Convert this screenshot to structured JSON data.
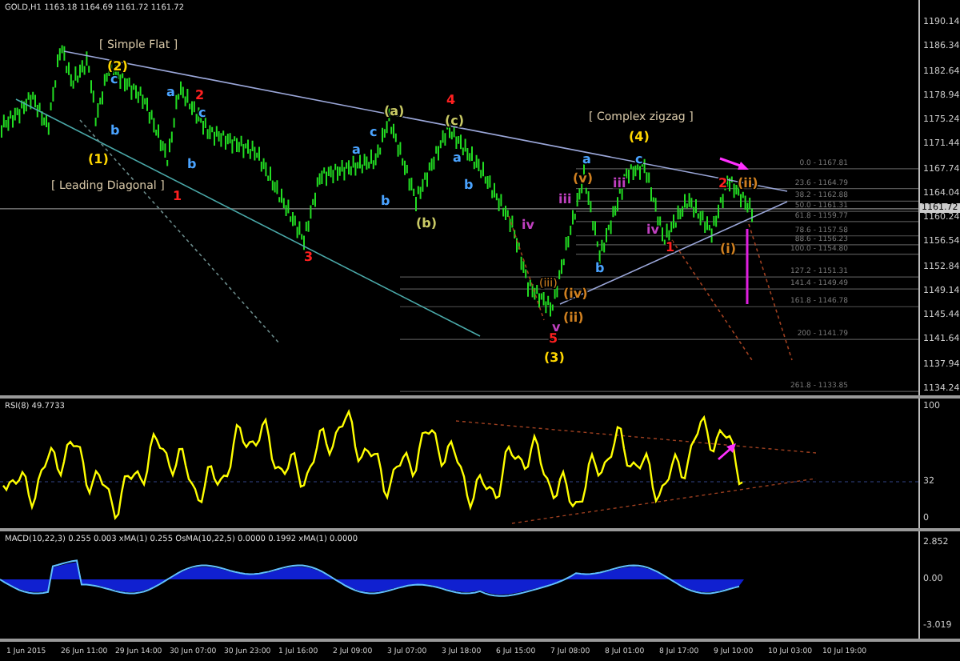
{
  "header": "GOLD,H1  1163.18 1164.69 1161.72 1161.72",
  "price_axis": {
    "ticks": [
      "1190.14",
      "1186.34",
      "1182.64",
      "1178.94",
      "1175.24",
      "1171.44",
      "1167.74",
      "1164.04",
      "1160.24",
      "1156.54",
      "1152.84",
      "1149.14",
      "1145.44",
      "1141.64",
      "1137.94",
      "1134.24"
    ],
    "current": "1161.72"
  },
  "fib_levels": [
    "0.0 - 1167.81",
    "23.6 - 1164.79",
    "38.2 - 1162.88",
    "50.0 - 1161.31",
    "61.8 - 1159.77",
    "78.6 - 1157.58",
    "88.6 - 1156.23",
    "100.0 - 1154.80",
    "127.2 - 1151.31",
    "141.4 - 1149.49",
    "161.8 - 1146.78",
    "200 - 1141.79",
    "261.8 - 1133.85"
  ],
  "wave_labels": [
    {
      "text": "[ Simple Flat ]",
      "color": "#d8c8a8"
    },
    {
      "text": "(2)",
      "color": "#ffd700"
    },
    {
      "text": "c",
      "color": "#4aa3ff"
    },
    {
      "text": "a",
      "color": "#4aa3ff"
    },
    {
      "text": "2",
      "color": "#ff2020"
    },
    {
      "text": "4",
      "color": "#ff2020"
    },
    {
      "text": "c",
      "color": "#4aa3ff"
    },
    {
      "text": "(a)",
      "color": "#c8c864"
    },
    {
      "text": "(c)",
      "color": "#c8c864"
    },
    {
      "text": "[ Complex zigzag ]",
      "color": "#d8c8a8"
    },
    {
      "text": "b",
      "color": "#4aa3ff"
    },
    {
      "text": "c",
      "color": "#4aa3ff"
    },
    {
      "text": "(4)",
      "color": "#ffd700"
    },
    {
      "text": "(1)",
      "color": "#ffd700"
    },
    {
      "text": "b",
      "color": "#4aa3ff"
    },
    {
      "text": "a",
      "color": "#4aa3ff"
    },
    {
      "text": "a",
      "color": "#4aa3ff"
    },
    {
      "text": "a",
      "color": "#4aa3ff"
    },
    {
      "text": "c",
      "color": "#4aa3ff"
    },
    {
      "text": "[ Leading Diagonal ]",
      "color": "#d8c8a8"
    },
    {
      "text": "b",
      "color": "#4aa3ff"
    },
    {
      "text": "(v)",
      "color": "#d08020"
    },
    {
      "text": "iii",
      "color": "#c040c0"
    },
    {
      "text": "2",
      "color": "#ff2020"
    },
    {
      "text": "(ii)",
      "color": "#d08020"
    },
    {
      "text": "1",
      "color": "#ff2020"
    },
    {
      "text": "b",
      "color": "#4aa3ff"
    },
    {
      "text": "iii",
      "color": "#c040c0"
    },
    {
      "text": "(b)",
      "color": "#c8c864"
    },
    {
      "text": "iv",
      "color": "#c040c0"
    },
    {
      "text": "iv",
      "color": "#c040c0"
    },
    {
      "text": "3",
      "color": "#ff2020"
    },
    {
      "text": "1",
      "color": "#ff2020"
    },
    {
      "text": "(i)",
      "color": "#d08020"
    },
    {
      "text": "b",
      "color": "#4aa3ff"
    },
    {
      "text": "(iii)",
      "color": "#d08020"
    },
    {
      "text": "(iv)",
      "color": "#d08020"
    },
    {
      "text": "(ii)",
      "color": "#d08020"
    },
    {
      "text": "v",
      "color": "#c040c0"
    },
    {
      "text": "5",
      "color": "#ff2020"
    },
    {
      "text": "(3)",
      "color": "#ffd700"
    }
  ],
  "rsi": {
    "title": "RSI(8) 49.7733",
    "ticks": [
      "100",
      "32",
      "0"
    ]
  },
  "macd": {
    "title": "MACD(10,22,3) 0.255 0.003  xMA(1) 0.255  OsMA(10,22,5) 0.0000 0.1992  xMA(1) 0.0000",
    "ticks": [
      "2.852",
      "0.00",
      "-3.019"
    ]
  },
  "time_axis": [
    "1 Jun 2015",
    "26 Jun 11:00",
    "29 Jun 14:00",
    "30 Jun 07:00",
    "30 Jun 23:00",
    "1 Jul 16:00",
    "2 Jul 09:00",
    "3 Jul 07:00",
    "3 Jul 18:00",
    "6 Jul 15:00",
    "7 Jul 08:00",
    "8 Jul 01:00",
    "8 Jul 17:00",
    "9 Jul 10:00",
    "10 Jul 03:00",
    "10 Jul 19:00"
  ]
}
